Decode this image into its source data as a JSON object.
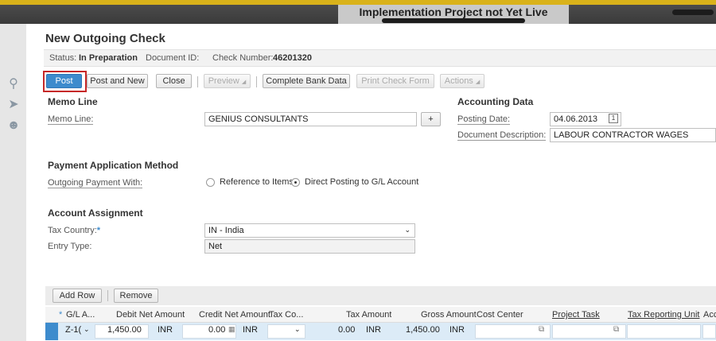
{
  "banner": "Implementation Project not Yet Live",
  "dialog": {
    "title": "New Outgoing Check",
    "status_label": "Status:",
    "status_value": "In Preparation",
    "docid_label": "Document ID:",
    "checknum_label": "Check Number:",
    "checknum_value": "46201320"
  },
  "toolbar": {
    "post": "Post",
    "post_new": "Post and New",
    "close": "Close",
    "preview": "Preview",
    "complete_bank": "Complete Bank Data",
    "print_check": "Print Check Form",
    "actions": "Actions"
  },
  "memo": {
    "section": "Memo Line",
    "label": "Memo Line:",
    "value": "GENIUS CONSULTANTS",
    "plus": "+"
  },
  "accounting": {
    "section": "Accounting Data",
    "posting_date_label": "Posting Date:",
    "posting_date": "04.06.2013",
    "doc_desc_label": "Document Description:",
    "doc_desc": "LABOUR CONTRACTOR WAGES"
  },
  "payment": {
    "section": "Payment Application Method",
    "label": "Outgoing Payment With:",
    "opt1": "Reference to Items",
    "opt2": "Direct Posting to G/L Account",
    "selected": "Direct Posting to G/L Account"
  },
  "assignment": {
    "section": "Account Assignment",
    "tax_country_label": "Tax Country:",
    "tax_country": "IN - India",
    "entry_type_label": "Entry Type:",
    "entry_type": "Net"
  },
  "table": {
    "add_row": "Add Row",
    "remove": "Remove",
    "headers": {
      "gl": "G/L A...",
      "debit": "Debit Net Amount",
      "credit": "Credit Net Amount",
      "taxcode": "Tax Co...",
      "tax": "Tax Amount",
      "gross": "Gross Amount",
      "cost": "Cost Center",
      "project": "Project Task",
      "reporting": "Tax Reporting Unit",
      "acc": "Acc"
    },
    "row": {
      "gl": "Z-1(",
      "debit": "1,450.00",
      "debit_cur": "INR",
      "credit": "0.00",
      "credit_cur": "INR",
      "tax": "0.00",
      "tax_cur": "INR",
      "gross": "1,450.00",
      "gross_cur": "INR"
    }
  },
  "colors": {
    "accent": "#3d8bcd",
    "highlight_box": "#c62828",
    "banner_gold": "#d9b21a"
  }
}
